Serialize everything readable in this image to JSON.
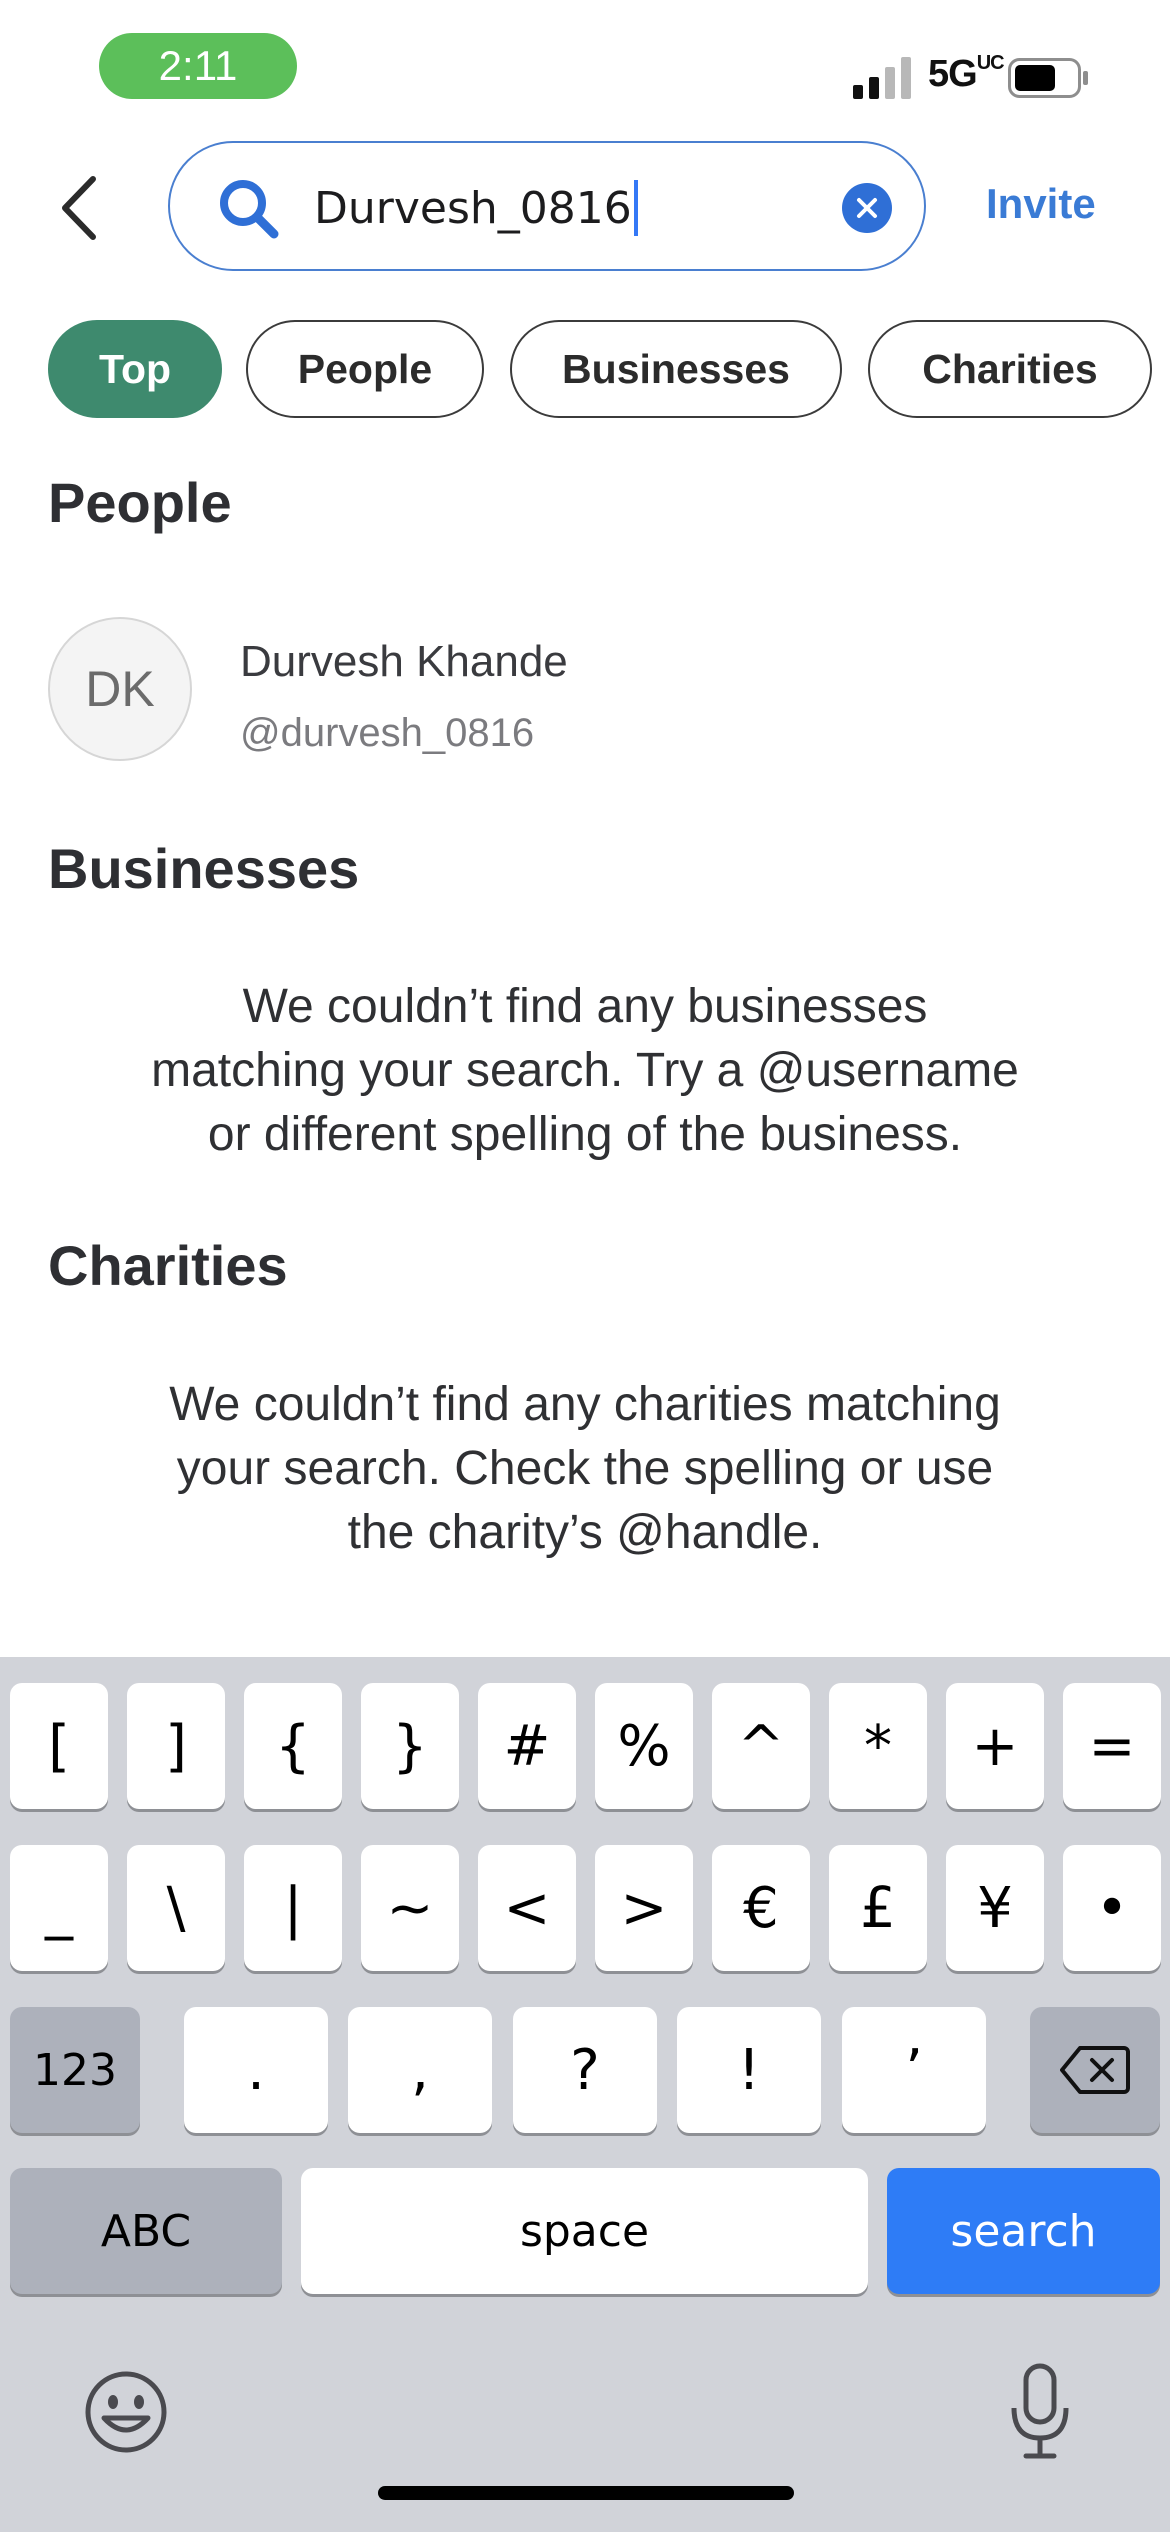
{
  "status_bar": {
    "time": "2:11",
    "network": "5G",
    "network_suffix": "UC",
    "icons": [
      "signal-icon",
      "battery-icon"
    ]
  },
  "search": {
    "value": "Durvesh_0816",
    "invite_label": "Invite",
    "icons": [
      "back-chevron-icon",
      "search-icon",
      "clear-icon"
    ]
  },
  "filters": {
    "tabs": [
      "Top",
      "People",
      "Businesses",
      "Charities"
    ],
    "active": "Top"
  },
  "people": {
    "title": "People",
    "results": [
      {
        "initials": "DK",
        "name": "Durvesh Khande",
        "handle": "@durvesh_0816"
      }
    ]
  },
  "businesses": {
    "title": "Businesses",
    "empty_lines": [
      "We couldn’t find any businesses",
      "matching your search. Try a @username",
      "or different spelling of the business."
    ]
  },
  "charities": {
    "title": "Charities",
    "empty_lines": [
      "We couldn’t find any charities matching",
      "your search. Check the spelling or use",
      "the charity’s @handle."
    ]
  },
  "keyboard": {
    "row1": [
      "[",
      "]",
      "{",
      "}",
      "#",
      "%",
      "^",
      "*",
      "+",
      "="
    ],
    "row2": [
      "_",
      "\\",
      "|",
      "~",
      "<",
      ">",
      "€",
      "£",
      "¥",
      "•"
    ],
    "row3": [
      ".",
      ",",
      "?",
      "!",
      "’"
    ],
    "numbers_label": "123",
    "abc_label": "ABC",
    "space_label": "space",
    "search_label": "search",
    "icons": [
      "delete-icon",
      "emoji-icon",
      "microphone-icon"
    ],
    "accent": "#2e7cf6"
  },
  "colors": {
    "active_chip": "#3e8a6e",
    "link": "#3a7bd5",
    "time_pill": "#5cbf5a"
  }
}
